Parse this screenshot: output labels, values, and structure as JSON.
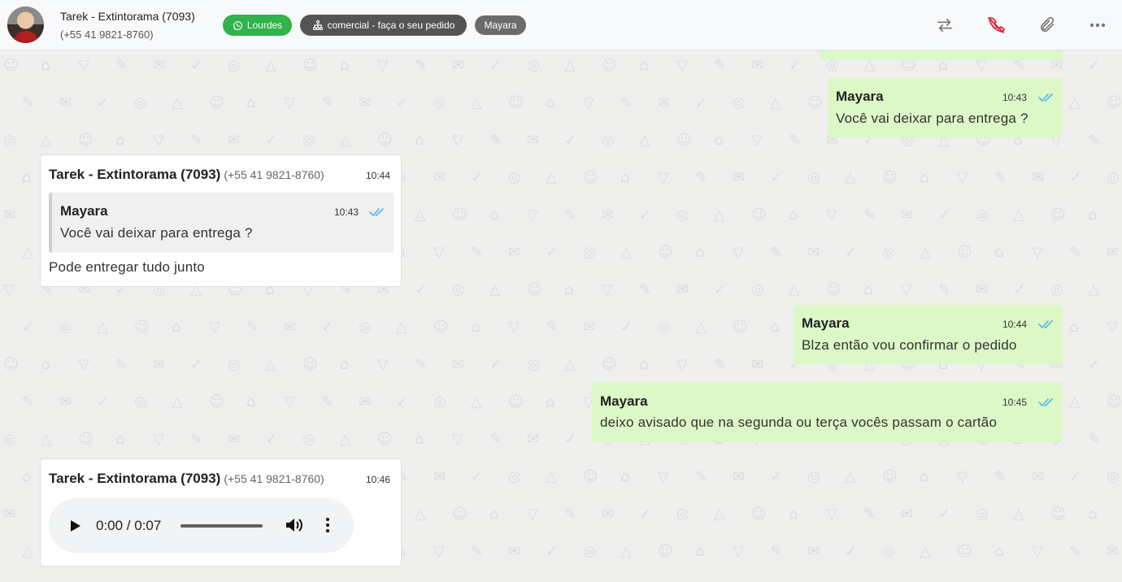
{
  "header": {
    "contact_name": "Tarek - Extintorama (7093)",
    "contact_phone": "(+55 41 9821-8760)",
    "tags": {
      "whatsapp_label": "Lourdes",
      "queue_label": "comercial - faça o seu pedido",
      "user_label": "Mayara"
    },
    "icons": [
      "transfer-icon",
      "end-call-icon",
      "attachment-icon",
      "more-options-icon"
    ]
  },
  "messages": [
    {
      "type": "out",
      "sender": "Mayara",
      "time": "10:43",
      "text": "Você vai deixar para entrega ?"
    },
    {
      "type": "in",
      "sender": "Tarek - Extintorama (7093)",
      "sender_phone": "(+55 41 9821-8760)",
      "time": "10:44",
      "quoted": {
        "sender": "Mayara",
        "time": "10:43",
        "text": "Você vai deixar para entrega ?"
      },
      "text": "Pode entregar tudo junto"
    },
    {
      "type": "out",
      "sender": "Mayara",
      "time": "10:44",
      "text": "Blza então vou confirmar o pedido"
    },
    {
      "type": "out",
      "sender": "Mayara",
      "time": "10:45",
      "text": "deixo avisado que na segunda ou terça vocês passam o cartão"
    },
    {
      "type": "in-audio",
      "sender": "Tarek - Extintorama (7093)",
      "sender_phone": "(+55 41 9821-8760)",
      "time": "10:46",
      "audio_time": "0:00 / 0:07"
    }
  ],
  "colors": {
    "outgoing_bubble": "#dcf8c6",
    "incoming_bubble": "#ffffff",
    "read_ticks": "#4fb6ec",
    "tag_green": "#2fb34a",
    "end_call_red": "#d8243a"
  }
}
